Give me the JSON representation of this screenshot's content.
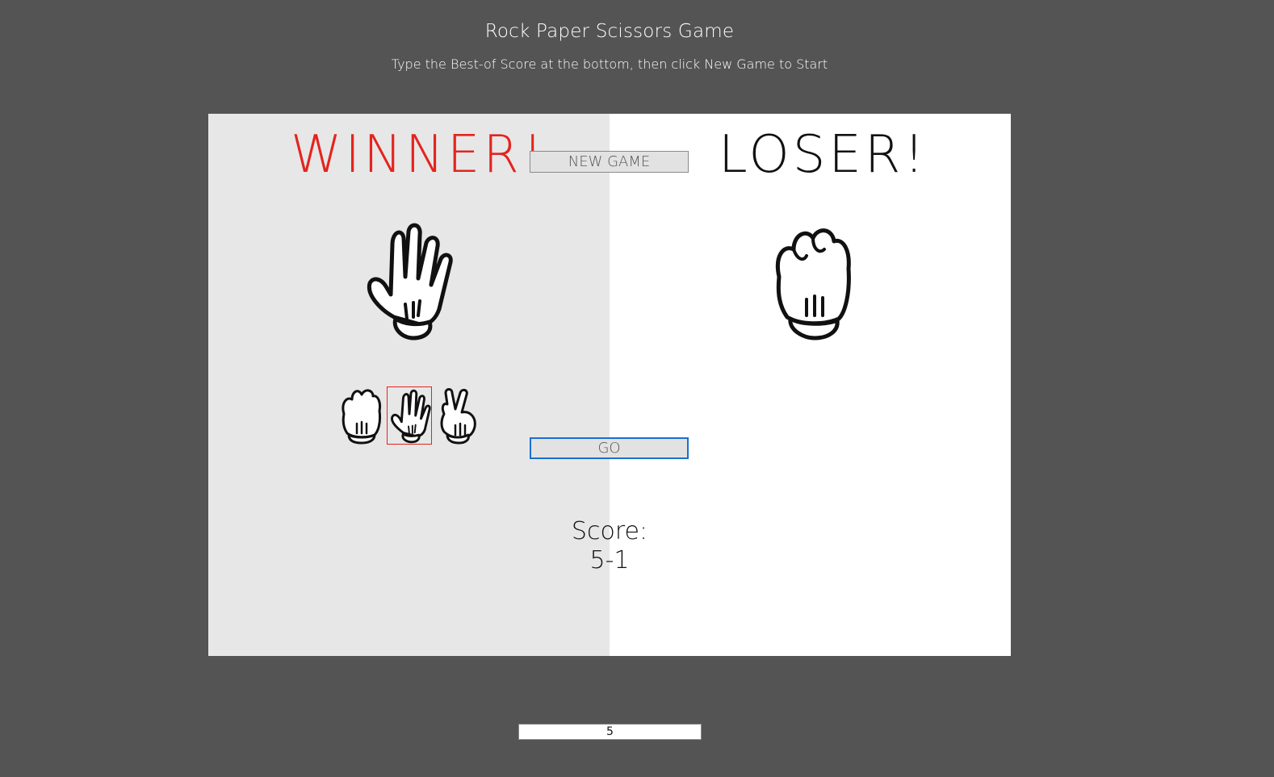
{
  "header": {
    "title": "Rock Paper Scissors Game",
    "subtitle": "Type the Best-of Score at the bottom, then click New Game to Start"
  },
  "game": {
    "player_result": "WINNER!",
    "cpu_result": "LOSER!",
    "new_game_label": "NEW GAME",
    "go_label": "GO",
    "player_hand": "paper-hand-icon",
    "cpu_hand": "rock-hand-icon",
    "choices": [
      "rock-hand-icon",
      "paper-hand-icon",
      "scissors-hand-icon"
    ],
    "selected_choice": "paper",
    "score_label": "Score:",
    "score_value": "5-1"
  },
  "best_of": {
    "value": "5"
  },
  "colors": {
    "background": "#545454",
    "winner": "#e3241e",
    "loser": "#111111",
    "player_panel": "#e7e7e7",
    "cpu_panel": "#ffffff",
    "go_border": "#1a6fd0"
  }
}
